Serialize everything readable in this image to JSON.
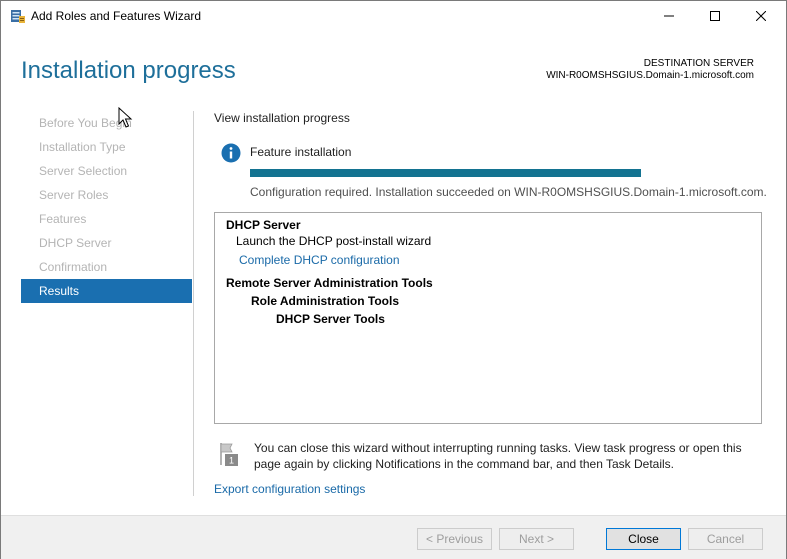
{
  "window": {
    "title": "Add Roles and Features Wizard"
  },
  "header": {
    "page_title": "Installation progress",
    "destination_label": "DESTINATION SERVER",
    "destination_name": "WIN-R0OMSHSGIUS.Domain-1.microsoft.com"
  },
  "nav": {
    "items": [
      {
        "label": "Before You Begin",
        "state": "disabled"
      },
      {
        "label": "Installation Type",
        "state": "disabled"
      },
      {
        "label": "Server Selection",
        "state": "disabled"
      },
      {
        "label": "Server Roles",
        "state": "disabled"
      },
      {
        "label": "Features",
        "state": "disabled"
      },
      {
        "label": "DHCP Server",
        "state": "disabled"
      },
      {
        "label": "Confirmation",
        "state": "disabled"
      },
      {
        "label": "Results",
        "state": "active"
      }
    ]
  },
  "main": {
    "view_progress_label": "View installation progress",
    "feature_installation_label": "Feature installation",
    "progress_fraction": 1.0,
    "status_text": "Configuration required. Installation succeeded on WIN-R0OMSHSGIUS.Domain-1.microsoft.com.",
    "results": {
      "dhcp_server": "DHCP Server",
      "launch_wizard": "Launch the DHCP post-install wizard",
      "complete_dhcp_link": "Complete DHCP configuration",
      "rsat": "Remote Server Administration Tools",
      "role_admin_tools": "Role Administration Tools",
      "dhcp_server_tools": "DHCP Server Tools"
    },
    "note_badge": "1",
    "note_text": "You can close this wizard without interrupting running tasks. View task progress or open this page again by clicking Notifications in the command bar, and then Task Details.",
    "export_link": "Export configuration settings"
  },
  "footer": {
    "previous_label": "< Previous",
    "next_label": "Next >",
    "close_label": "Close",
    "cancel_label": "Cancel"
  },
  "colors": {
    "title_blue": "#1e6f9a",
    "nav_active": "#1a6fb0",
    "progress_fill": "#137391",
    "link": "#1a6aa8"
  },
  "icons": {
    "app": "server-manager-icon",
    "info": "info-icon",
    "flag": "notification-flag-icon"
  }
}
